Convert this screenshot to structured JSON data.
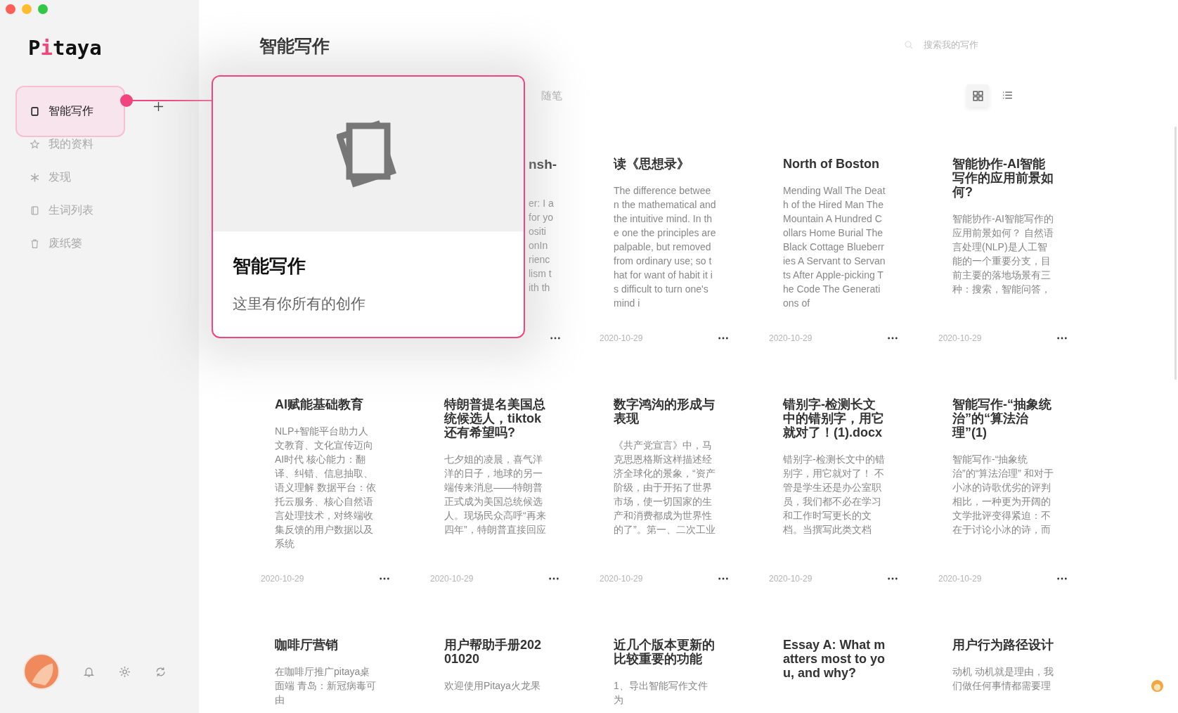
{
  "logo": [
    {
      "text": "P",
      "accent": false
    },
    {
      "text": "i",
      "accent": true
    },
    {
      "text": "taya",
      "accent": false
    }
  ],
  "sidebar": {
    "items": [
      {
        "label": "智能写作",
        "selected": true
      },
      {
        "label": "我的资料",
        "selected": false
      },
      {
        "label": "发现",
        "selected": false
      },
      {
        "label": "生词列表",
        "selected": false
      },
      {
        "label": "废纸篓",
        "selected": false
      }
    ]
  },
  "page_title": "智能写作",
  "search": {
    "placeholder": "搜索我的写作"
  },
  "tabs": [
    {
      "label": "随笔",
      "selected": false
    }
  ],
  "view_modes": [
    {
      "kind": "grid",
      "selected": true
    },
    {
      "kind": "list",
      "selected": false
    }
  ],
  "guide": {
    "title": "智能写作",
    "subtitle": "这里有你所有的创作"
  },
  "cards": [
    {
      "kind": "partial",
      "title": "nsh-",
      "lines": [
        "er: I a",
        "for yo",
        "ositi",
        "onIn",
        "rienc",
        "lism t",
        "ith th"
      ]
    },
    {
      "kind": "full",
      "title": "读《思想录》",
      "body": "The difference between the mathematical and the intuitive mind. In the one the principles are palpable, but removed from ordinary use; so that for want of habit it is difficult to turn one's mind i",
      "date": "2020-10-29"
    },
    {
      "kind": "full",
      "title": "North of Boston",
      "body": "Mending Wall The Death of the Hired Man The Mountain A Hundred Collars Home Burial The Black Cottage Blueberries A Servant to Servants After Apple-picking The Code The Generations of",
      "date": "2020-10-29"
    },
    {
      "kind": "full",
      "title": "智能协作-AI智能写作的应用前景如何?",
      "body": "智能协作-AI智能写作的应用前景如何？ 自然语言处理(NLP)是人工智能的一个重要分支，目前主要的落地场景有三种：搜索，智能问答，",
      "date": "2020-10-29"
    },
    {
      "kind": "full",
      "title": "AI赋能基础教育",
      "body": "NLP+智能平台助力人文教育、文化宣传迈向AI时代 核心能力：翻译、纠错、信息抽取、语义理解 数据平台：依托云服务、核心自然语言处理技术，对终端收集反馈的用户数据以及系统",
      "date": "2020-10-29"
    },
    {
      "kind": "full",
      "title": "特朗普提名美国总统候选人，tiktok还有希望吗?",
      "body": "七夕姐的凌晨，喜气洋洋的日子，地球的另一端传来消息——特朗普正式成为美国总统候选人。现场民众高呼“再来四年”，特朗普直接回应",
      "date": "2020-10-29"
    },
    {
      "kind": "full",
      "title": "数字鸿沟的形成与表现",
      "body": "《共产党宣言》中，马克思恩格斯这样描述经济全球化的景象，“资产阶级，由于开拓了世界市场，使一切国家的生产和消费都成为世界性的了”。第一、二次工业",
      "date": "2020-10-29"
    },
    {
      "kind": "full",
      "title": "错别字-检测长文中的错别字，用它就对了！(1).docx",
      "body": "错别字-检测长文中的错别字，用它就对了！ 不管是学生还是办公室职员，我们都不必在学习和工作时写更长的文档。当撰写此类文档",
      "date": "2020-10-29"
    },
    {
      "kind": "full",
      "title": "智能写作-“抽象统治”的“算法治理”(1)",
      "body": "智能写作-“抽象统治”的“算法治理” 和对于小冰的诗歌优劣的评判相比，一种更为开阔的文学批评变得紧迫：不在于讨论小冰的诗，而",
      "date": "2020-10-29"
    },
    {
      "kind": "full",
      "title": "咖啡厅营销",
      "body": "在咖啡厅推广pitaya桌面端 青岛：新冠病毒可由"
    },
    {
      "kind": "full",
      "title": "用户帮助手册20201020",
      "body": "欢迎使用Pitaya火龙果"
    },
    {
      "kind": "full",
      "title": "近几个版本更新的比较重要的功能",
      "body": "1、导出智能写作文件为"
    },
    {
      "kind": "full",
      "title": "Essay A: What matters most to you, and why?"
    },
    {
      "kind": "full",
      "title": "用户行为路径设计",
      "body": "动机 动机就是理由，我们做任何事情都需要理"
    }
  ]
}
